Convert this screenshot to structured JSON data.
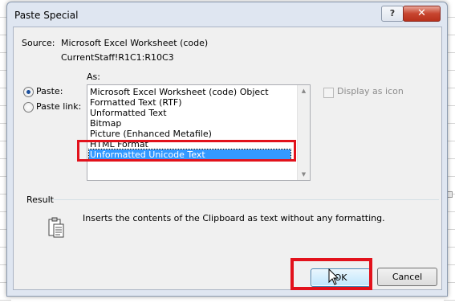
{
  "dialog": {
    "title": "Paste Special",
    "help_label": "?",
    "close_label": "✕"
  },
  "source": {
    "label": "Source:",
    "value": "Microsoft Excel Worksheet (code)",
    "range": "CurrentStaff!R1C1:R10C3"
  },
  "as_label": "As:",
  "options": {
    "paste_label": "Paste:",
    "paste_link_label": "Paste link:",
    "selected": "paste"
  },
  "list": {
    "items": [
      "Microsoft Excel Worksheet (code) Object",
      "Formatted Text (RTF)",
      "Unformatted Text",
      "Bitmap",
      "Picture (Enhanced Metafile)",
      "HTML Format",
      "Unformatted Unicode Text"
    ],
    "selected_index": 6
  },
  "display_as_icon": {
    "label": "Display as icon",
    "checked": false,
    "enabled": false
  },
  "result": {
    "label": "Result",
    "text": "Inserts the contents of the Clipboard as text without any formatting."
  },
  "buttons": {
    "ok": "OK",
    "cancel": "Cancel"
  },
  "colors": {
    "highlight": "#e2121c",
    "selection": "#3399ff"
  }
}
